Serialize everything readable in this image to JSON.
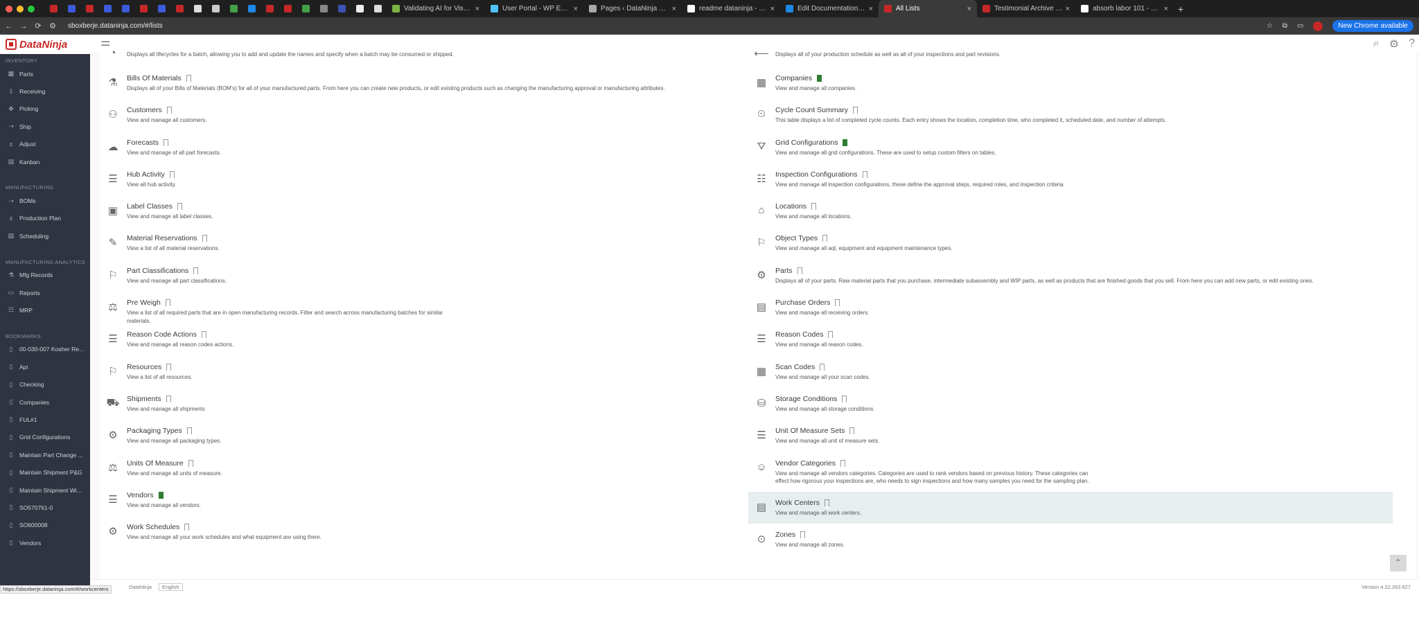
{
  "browser": {
    "tabs": [
      {
        "title": "Validating AI for Visual Inspec",
        "color": "#7cb342"
      },
      {
        "title": "User Portal - WP Engine",
        "color": "#4fc3f7"
      },
      {
        "title": "Pages ‹ DataNinja — WordPre",
        "color": "#aaaaaa"
      },
      {
        "title": "readme dataninja - Google Se",
        "color": "#ffffff"
      },
      {
        "title": "Edit Documentation · ReadMe",
        "color": "#1e88e5"
      },
      {
        "title": "All Lists",
        "color": "#c62828"
      },
      {
        "title": "Testimonial Archive - Datani",
        "color": "#c62828"
      },
      {
        "title": "absorb labor 101 - Google Se",
        "color": "#ffffff"
      }
    ],
    "url": "sboxberje.dataninja.com/#/lists",
    "update_label": "New Chrome available",
    "status_url": "https://sboxberje.dataninja.com/#/workcenters"
  },
  "app": {
    "logo_text": "DataNinja"
  },
  "sidebar": {
    "sections": [
      {
        "title": "INVENTORY",
        "items": [
          "Parts",
          "Receiving",
          "Picking",
          "Ship",
          "Adjust",
          "Kanban"
        ]
      },
      {
        "title": "MANUFACTURING",
        "items": [
          "BOMs",
          "Production Plan",
          "Scheduling"
        ]
      },
      {
        "title": "MANUFACTURING ANALYTICS",
        "items": [
          "Mfg Records",
          "Reports",
          "MRP"
        ]
      },
      {
        "title": "BOOKMARKS",
        "items": [
          "00-030-007 Kosher Rec...",
          "Api",
          "Checking",
          "Companies",
          "FUL#1",
          "Grid Configurations",
          "Maintain Part Change ...",
          "Maintain Shipment P&G",
          "Maintain Shipment Wi...",
          "SO570761-0",
          "SO600008",
          "Vendors"
        ]
      }
    ]
  },
  "lists": {
    "left": [
      {
        "title": "",
        "desc": "Displays all lifecycles for a batch, allowing you to add and update the names and specify when a batch may be consumed or shipped.",
        "bookmarked": false
      },
      {
        "title": "Bills Of Materials",
        "desc": "Displays all of your Bills of Materials (BOM's) for all of your manufactured parts. From here you can create new products, or edit existing products such as changing the manufacturing approval or manufacturing attributes.",
        "bookmarked": false
      },
      {
        "title": "Customers",
        "desc": "View and manage all customers.",
        "bookmarked": false
      },
      {
        "title": "Forecasts",
        "desc": "View and manage of all part forecasts.",
        "bookmarked": false
      },
      {
        "title": "Hub Activity",
        "desc": "View all hub activity.",
        "bookmarked": false
      },
      {
        "title": "Label Classes",
        "desc": "View and manage all label classes.",
        "bookmarked": false
      },
      {
        "title": "Material Reservations",
        "desc": "View a list of all material reservations.",
        "bookmarked": false
      },
      {
        "title": "Part Classifications",
        "desc": "View and manage all part classifications.",
        "bookmarked": false
      },
      {
        "title": "Pre Weigh",
        "desc": "View a list of all required parts that are in open manufacturing records. Filter and search across manufacturing batches for similar materials.",
        "bookmarked": false
      },
      {
        "title": "Reason Code Actions",
        "desc": "View and manage all reason codes actions.",
        "bookmarked": false
      },
      {
        "title": "Resources",
        "desc": "View a list of all resources.",
        "bookmarked": false
      },
      {
        "title": "Shipments",
        "desc": "View and manage all shipments",
        "bookmarked": false
      },
      {
        "title": "Packaging Types",
        "desc": "View and manage all packaging types.",
        "bookmarked": false
      },
      {
        "title": "Units Of Measure",
        "desc": "View and manage all units of measure.",
        "bookmarked": false
      },
      {
        "title": "Vendors",
        "desc": "View and manage all vendors.",
        "bookmarked": true
      },
      {
        "title": "Work Schedules",
        "desc": "View and manage all your work schedules and what equipment are using them.",
        "bookmarked": false
      }
    ],
    "right": [
      {
        "title": "",
        "desc": "Displays all of your production schedule as well as all of your inspections and part revisions.",
        "bookmarked": false
      },
      {
        "title": "Companies",
        "desc": "View and manage all companies.",
        "bookmarked": true
      },
      {
        "title": "Cycle Count Summary",
        "desc": "This table displays a list of completed cycle counts. Each entry shows the location, completion time, who completed it, scheduled date, and number of attempts.",
        "bookmarked": false
      },
      {
        "title": "Grid Configurations",
        "desc": "View and manage all grid configurations. These are used to setup custom filters on tables.",
        "bookmarked": true
      },
      {
        "title": "Inspection Configurations",
        "desc": "View and manage all inspection configurations, these define the approval steps, required roles, and inspection criteria",
        "bookmarked": false
      },
      {
        "title": "Locations",
        "desc": "View and manage all locations.",
        "bookmarked": false
      },
      {
        "title": "Object Types",
        "desc": "View and manage all aql, equipment and equipment maintenance types.",
        "bookmarked": false
      },
      {
        "title": "Parts",
        "desc": "Displays all of your parts. Raw material parts that you purchase, intermediate subassembly and WIP parts, as well as products that are finished goods that you sell. From here you can add new parts, or edit existing ones.",
        "bookmarked": false
      },
      {
        "title": "Purchase Orders",
        "desc": "View and manage all receiving orders.",
        "bookmarked": false
      },
      {
        "title": "Reason Codes",
        "desc": "View and manage all reason codes.",
        "bookmarked": false
      },
      {
        "title": "Scan Codes",
        "desc": "View and manage all your scan codes.",
        "bookmarked": false
      },
      {
        "title": "Storage Conditions",
        "desc": "View and manage all storage conditions.",
        "bookmarked": false
      },
      {
        "title": "Unit Of Measure Sets",
        "desc": "View and manage all unit of measure sets.",
        "bookmarked": false
      },
      {
        "title": "Vendor Categories",
        "desc": "View and manage all vendors categories. Categories are used to rank vendors based on previous history. These categories can effect how rigorous your inspections are, who needs to sign inspections and how many samples you need for the sampling plan.",
        "bookmarked": false
      },
      {
        "title": "Work Centers",
        "desc": "View and manage all work centers.",
        "bookmarked": false
      },
      {
        "title": "Zones",
        "desc": "View and manage all zones.",
        "bookmarked": false
      }
    ]
  },
  "footer": {
    "brand": "DataNinja",
    "language": "English",
    "version": "Version 4.22.263.627"
  }
}
